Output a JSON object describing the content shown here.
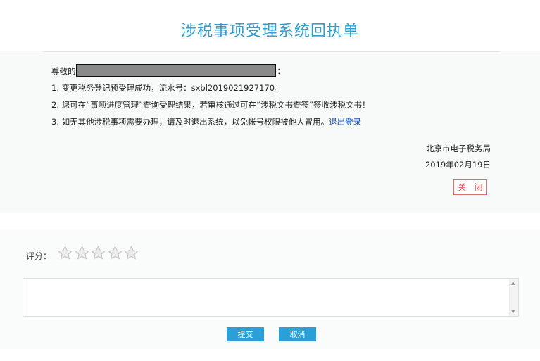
{
  "header": {
    "title": "涉税事项受理系统回执单"
  },
  "receipt": {
    "greeting_prefix": "尊敬的",
    "greeting_suffix": "：",
    "line1": "1. 变更税务登记预受理成功，流水号：sxbl2019021927170。",
    "line2": "2. 您可在“事项进度管理”查询受理结果，若审核通过可在“涉税文书查签”签收涉税文书！",
    "line3_text": "3. 如无其他涉税事项需要办理，请及时退出系统，以免帐号权限被他人冒用。",
    "line3_link": "退出登录",
    "office": "北京市电子税务局",
    "date": "2019年02月19日",
    "close_label": "关 闭"
  },
  "rating": {
    "label": "评分：",
    "star_count": 5,
    "selected": 0
  },
  "comment": {
    "value": "",
    "placeholder": ""
  },
  "actions": {
    "submit_label": "提交",
    "cancel_label": "取消"
  },
  "colors": {
    "title": "#2f9fd3",
    "link": "#1a4fb8",
    "close_border": "#e06a6a",
    "button_bg": "#2aa0d6"
  }
}
